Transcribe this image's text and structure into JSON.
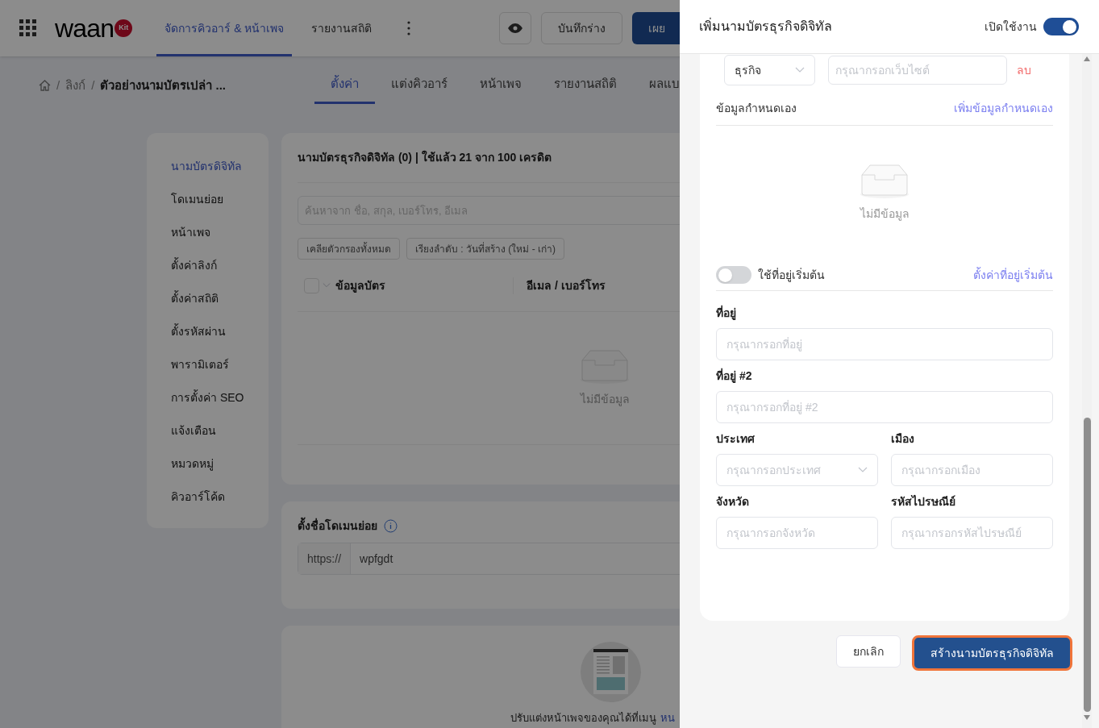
{
  "header": {
    "logo": {
      "word": "waan",
      "badge": "Kit"
    },
    "nav_tabs": [
      {
        "label": "จัดการคิวอาร์ & หน้าเพจ",
        "selected": true
      },
      {
        "label": "รายงานสถิติ",
        "selected": false
      }
    ],
    "buttons": [
      {
        "kind": "preview"
      },
      {
        "kind": "outline",
        "label": "บันทึกร่าง"
      },
      {
        "kind": "primary",
        "label": "เผย"
      }
    ]
  },
  "breadcrumb": {
    "separator": "/",
    "items": [
      "ลิงก์",
      "ตัวอย่างนามบัตรเปล่า ..."
    ]
  },
  "sub_tabs": [
    {
      "label": "ตั้งค่า",
      "selected": true
    },
    {
      "label": "แต่งคิวอาร์",
      "selected": false
    },
    {
      "label": "หน้าเพจ",
      "selected": false
    },
    {
      "label": "รายงานสถิติ",
      "selected": false
    },
    {
      "label": "ผลแบ",
      "selected": false
    }
  ],
  "sidebar": {
    "items": [
      {
        "label": "นามบัตรดิจิทัล",
        "selected": true
      },
      {
        "label": "โดเมนย่อย",
        "selected": false
      },
      {
        "label": "หน้าเพจ",
        "selected": false
      },
      {
        "label": "ตั้งค่าลิงก์",
        "selected": false
      },
      {
        "label": "ตั้งค่าสถิติ",
        "selected": false
      },
      {
        "label": "ตั้งรหัสผ่าน",
        "selected": false
      },
      {
        "label": "พารามิเตอร์",
        "selected": false
      },
      {
        "label": "การตั้งค่า SEO",
        "selected": false
      },
      {
        "label": "แจ้งเตือน",
        "selected": false
      },
      {
        "label": "หมวดหมู่",
        "selected": false
      },
      {
        "label": "คิวอาร์โค้ด",
        "selected": false
      }
    ]
  },
  "card_list": {
    "title": "นามบัตรธุรกิจดิจิทัล (0) | ใช้แล้ว 21 จาก 100 เครดิต",
    "search_placeholder": "ค้นหาจาก ชื่อ, สกุล, เบอร์โทร, อีเมล",
    "filters": [
      "เคลียตัวกรองทั้งหมด",
      "เรียงลำดับ : วันที่สร้าง (ใหม่ - เก่า)"
    ],
    "select_all": {
      "checked": false
    },
    "columns": [
      "ข้อมูลบัตร",
      "อีเมล / เบอร์โทร"
    ],
    "empty": "ไม่มีข้อมูล"
  },
  "subdomain": {
    "title": "ตั้งชื่อโดเมนย่อย",
    "prefix": "https://",
    "value": "wpfgdt"
  },
  "page_card": {
    "text": "ปรับแต่งหน้าเพจของคุณได้ที่เมนู",
    "link": "หน"
  },
  "drawer": {
    "title": "เพิ่มนามบัตรธุรกิจดิจิทัล",
    "enable": {
      "label": "เปิดใช้งาน",
      "on": true
    },
    "website_row": {
      "type_value": "ธุรกิจ",
      "placeholder": "กรุณากรอกเว็บไซต์",
      "remove": "ลบ"
    },
    "custom": {
      "title": "ข้อมูลกำหนดเอง",
      "add": "เพิ่มข้อมูลกำหนดเอง",
      "empty": "ไม่มีข้อมูล"
    },
    "default_address": {
      "label": "ใช้ที่อยู่เริ่มต้น",
      "on": false,
      "link": "ตั้งค่าที่อยู่เริ่มต้น"
    },
    "full_fields": [
      {
        "label": "ที่อยู่",
        "placeholder": "กรุณากรอกที่อยู่",
        "kind": "text"
      },
      {
        "label": "ที่อยู่ #2",
        "placeholder": "กรุณากรอกที่อยู่ #2",
        "kind": "text"
      }
    ],
    "pair_fields": [
      {
        "label": "ประเทศ",
        "placeholder": "กรุณากรอกประเทศ",
        "kind": "select"
      },
      {
        "label": "เมือง",
        "placeholder": "กรุณากรอกเมือง",
        "kind": "text"
      },
      {
        "label": "จังหวัด",
        "placeholder": "กรุณากรอกจังหวัด",
        "kind": "text"
      },
      {
        "label": "รหัสไปรษณีย์",
        "placeholder": "กรุณากรอกรหัสไปรษณีย์",
        "kind": "text"
      }
    ],
    "cancel": "ยกเลิก",
    "submit": "สร้างนามบัตรธุรกิจดิจิทัล"
  }
}
